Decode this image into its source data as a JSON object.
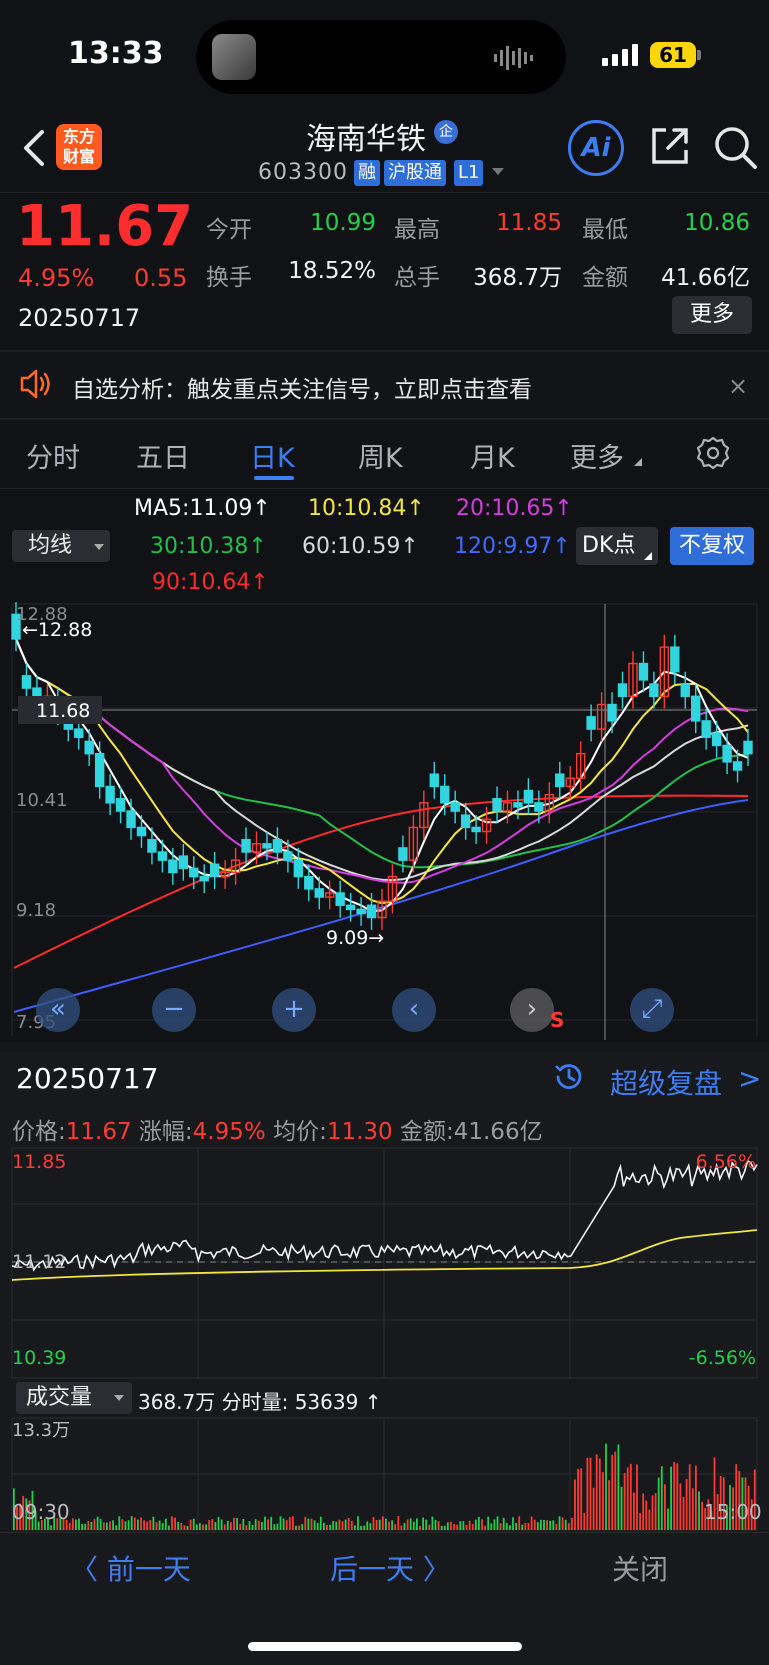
{
  "status_bar": {
    "time": "13:33",
    "battery": "61"
  },
  "header": {
    "logo_line1": "东方",
    "logo_line2": "财富",
    "stock_name": "海南华铁",
    "enterprise_badge": "企",
    "stock_code": "603300",
    "tags": [
      "融",
      "沪股通",
      "L1"
    ],
    "ai_label": "Ai"
  },
  "quote": {
    "price": "11.67",
    "change_pct": "4.95%",
    "change_abs": "0.55",
    "date": "20250717",
    "open_label": "今开",
    "open_value": "10.99",
    "high_label": "最高",
    "high_value": "11.85",
    "low_label": "最低",
    "low_value": "10.86",
    "turnover_label": "换手",
    "turnover_value": "18.52%",
    "volume_label": "总手",
    "volume_value": "368.7万",
    "amount_label": "金额",
    "amount_value": "41.66亿",
    "more_label": "更多"
  },
  "notice": {
    "text": "自选分析：触发重点关注信号，立即点击查看",
    "close": "×"
  },
  "tabs": [
    "分时",
    "五日",
    "日K",
    "周K",
    "月K",
    "更多"
  ],
  "ma_legend": {
    "select_label": "均线",
    "ma5": "MA5:11.09↑",
    "ma10": "10:10.84↑",
    "ma20": "20:10.65↑",
    "ma30": "30:10.38↑",
    "ma60": "60:10.59↑",
    "ma120": "120:9.97↑",
    "ma90": "90:10.64↑",
    "dk_label": "DK点",
    "adjust_label": "不复权"
  },
  "kline": {
    "axis_labels": [
      "12.88",
      "11.68",
      "10.41",
      "9.18",
      "7.95"
    ],
    "max_marker": "←12.88",
    "min_marker": "9.09→",
    "current_price_tag": "11.68",
    "s_marker": "S",
    "colors": {
      "up": "#ff3b30",
      "down": "#30d5e0",
      "ma5": "#ffffff",
      "ma10": "#f3e63a",
      "ma20": "#d63ce0",
      "ma30": "#22c04a",
      "ma60": "#d9d9d9",
      "ma90": "#ff2a2a",
      "ma120": "#3f5cff"
    },
    "controls": [
      "«",
      "−",
      "+",
      "‹",
      "›",
      "⤢"
    ]
  },
  "replay": {
    "date": "20250717",
    "link_label": "超级复盘",
    "chevron": ">",
    "price_label": "价格:",
    "price_value": "11.67",
    "pct_label": "涨幅:",
    "pct_value": "4.95%",
    "avg_label": "均价:",
    "avg_value": "11.30",
    "amount_label": "金额:",
    "amount_value": "41.66亿"
  },
  "minute_chart": {
    "max_price": "11.85",
    "mid_price": "11.12",
    "min_price": "10.39",
    "max_pct": "6.56%",
    "min_pct": "-6.56%"
  },
  "volume_panel": {
    "select_label": "成交量",
    "summary": "368.7万 分时量: 53639 ↑",
    "max_label": "13.3万",
    "time_start": "09:30",
    "time_end": "15:00"
  },
  "bottom_nav": {
    "prev": "〈 前一天",
    "next": "后一天 〉",
    "close": "关闭"
  }
}
